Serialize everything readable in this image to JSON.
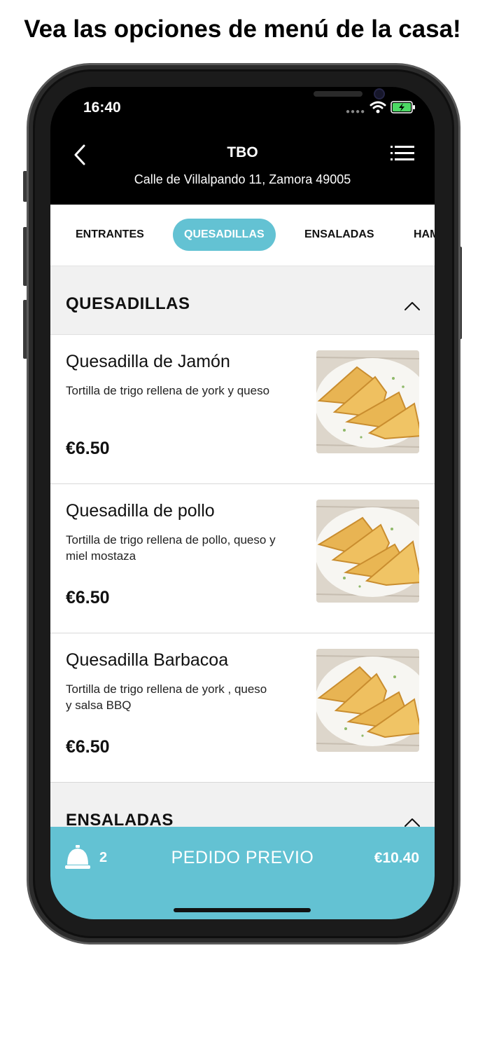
{
  "headline": "Vea las opciones de menú de la casa!",
  "status_bar": {
    "time": "16:40",
    "signal_icon": "signal-dots-icon",
    "wifi_icon": "wifi-icon",
    "battery_icon": "battery-charging-icon"
  },
  "header": {
    "title": "TBO",
    "address": "Calle de Villalpando 11, Zamora 49005",
    "back_icon": "chevron-left-icon",
    "menu_icon": "menu-lines-icon"
  },
  "tabs": [
    {
      "label": "ENTRANTES",
      "active": false
    },
    {
      "label": "QUESADILLAS",
      "active": true
    },
    {
      "label": "ENSALADAS",
      "active": false
    },
    {
      "label": "HAMBURGUESAS",
      "active": false
    }
  ],
  "sections": [
    {
      "title": "QUESADILLAS",
      "items": [
        {
          "name": "Quesadilla de Jamón",
          "description": "Tortilla de trigo rellena de york y queso",
          "price": "€6.50"
        },
        {
          "name": "Quesadilla de pollo",
          "description": "Tortilla de trigo rellena de pollo, queso y miel mostaza",
          "price": "€6.50"
        },
        {
          "name": "Quesadilla Barbacoa",
          "description": "Tortilla de trigo rellena de york , queso y salsa BBQ",
          "price": "€6.50"
        }
      ]
    },
    {
      "title": "ENSALADAS"
    }
  ],
  "order_bar": {
    "count": "2",
    "label": "PEDIDO PREVIO",
    "total": "€10.40",
    "icon": "service-bell-icon"
  },
  "colors": {
    "accent": "#63c2d3",
    "header_bg": "#000000",
    "content_bg": "#f1f1f1"
  }
}
